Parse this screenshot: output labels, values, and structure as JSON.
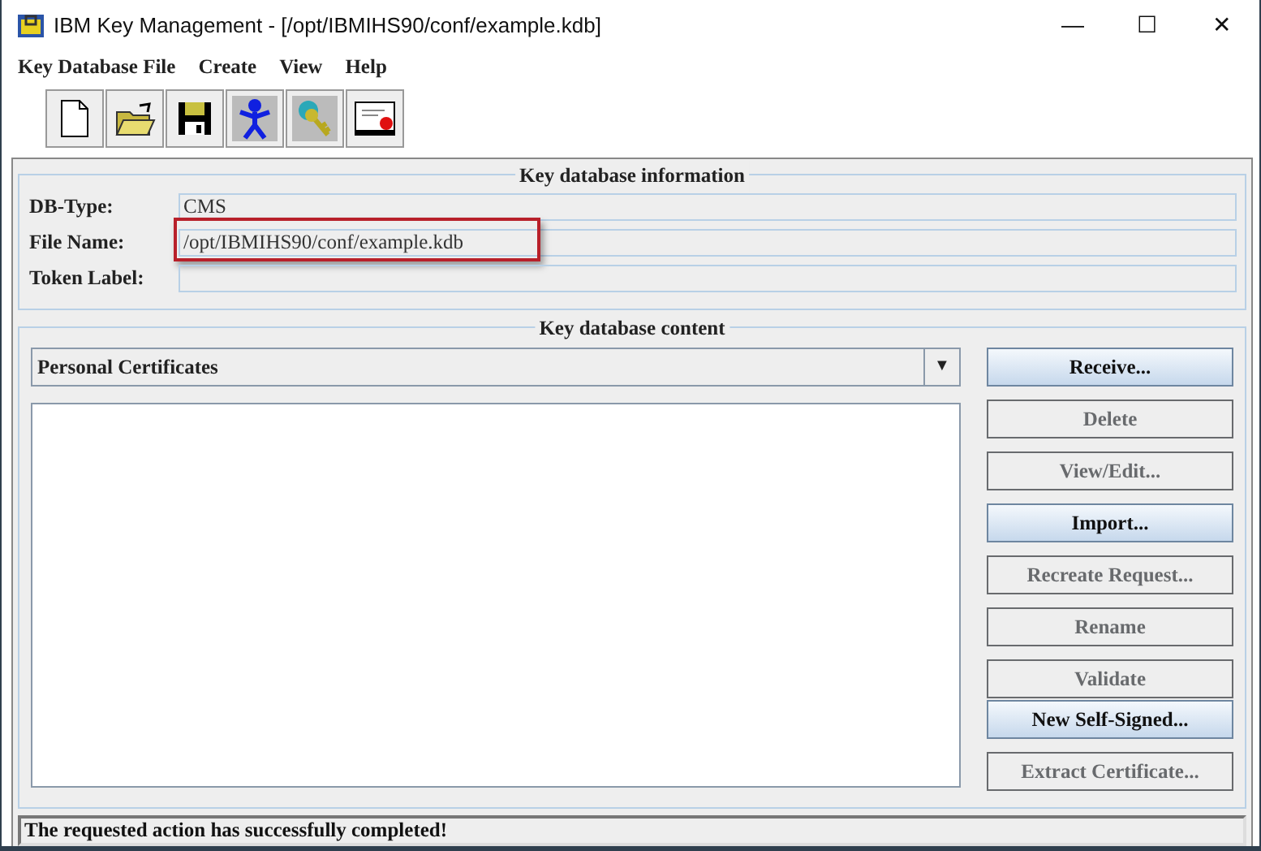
{
  "window": {
    "title": "IBM Key Management - [/opt/IBMIHS90/conf/example.kdb]",
    "controls": [
      "—",
      "☐",
      "✕"
    ]
  },
  "menu": [
    "Key Database File",
    "Create",
    "View",
    "Help"
  ],
  "toolbar": [
    {
      "kind": "new"
    },
    {
      "kind": "open"
    },
    {
      "kind": "save"
    },
    {
      "kind": "person"
    },
    {
      "kind": "key"
    },
    {
      "kind": "certificate"
    }
  ],
  "info": {
    "title": "Key database information",
    "fields": [
      {
        "label": "DB-Type:",
        "value": "CMS",
        "highlighted": false
      },
      {
        "label": "File Name:",
        "value": "/opt/IBMIHS90/conf/example.kdb",
        "highlighted": true
      },
      {
        "label": "Token Label:",
        "highlighted": false
      }
    ]
  },
  "content": {
    "title": "Key database content",
    "dropdown": {
      "value": "Personal Certificates",
      "arrow": "▼"
    },
    "buttons": [
      {
        "label": "Receive...",
        "disabled": false
      },
      {
        "label": "Delete",
        "disabled": true
      },
      {
        "label": "View/Edit...",
        "disabled": true
      },
      {
        "label": "Import...",
        "disabled": false
      },
      {
        "label": "Recreate Request...",
        "disabled": true
      },
      {
        "label": "Rename",
        "disabled": true
      },
      {
        "label": "Validate",
        "disabled": true
      },
      {
        "label": "New Self-Signed...",
        "disabled": false
      },
      {
        "label": "Extract Certificate...",
        "disabled": true
      }
    ]
  },
  "status_bar": "The requested action has successfully completed!"
}
